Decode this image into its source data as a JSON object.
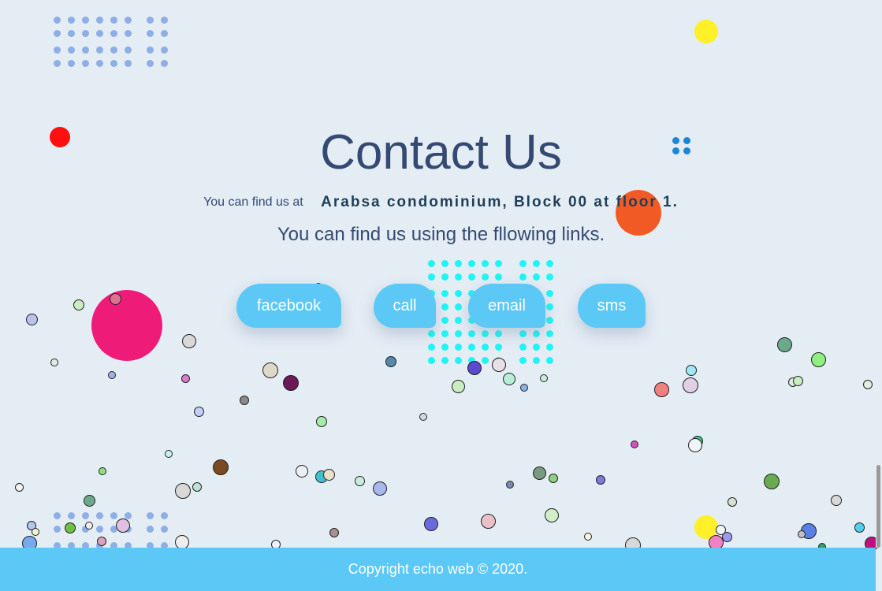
{
  "page": {
    "title": "Contact Us",
    "address_prefix": "You can find us at",
    "address_value": "Arabsa condominium, Block 00 at floor 1.",
    "links_intro": "You can find us using the fllowing links."
  },
  "links": [
    {
      "label": "facebook"
    },
    {
      "label": "call"
    },
    {
      "label": "email"
    },
    {
      "label": "sms"
    }
  ],
  "footer": {
    "copyright": "Copyright echo web © 2020."
  },
  "colors": {
    "background": "#e4ecf4",
    "accent": "#5bc8f5",
    "title": "#344a72",
    "address": "#1f3f57"
  }
}
